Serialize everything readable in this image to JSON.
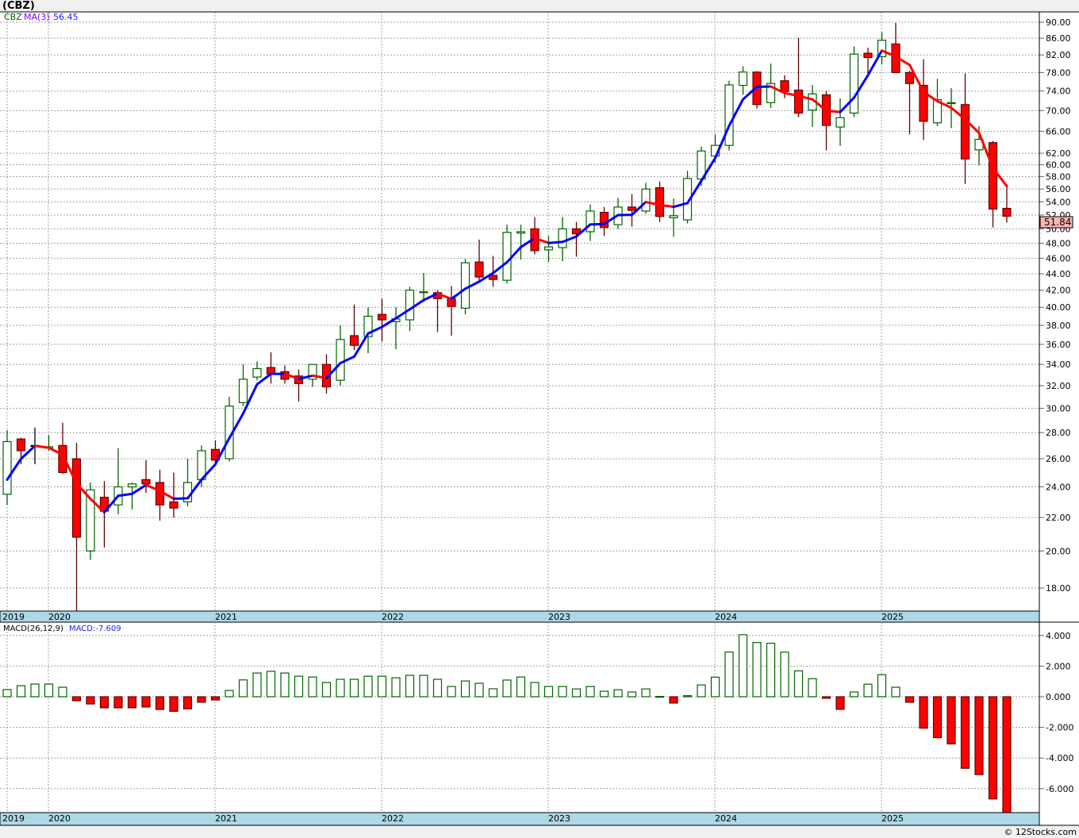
{
  "title": "(CBZ)",
  "legend": {
    "symbol": "CBZ",
    "ma_label": "MA(3)",
    "ma_value": "56.45"
  },
  "macd_legend": {
    "label": "MACD(26,12,9)",
    "value": "MACD:-7.609"
  },
  "last_price": "51.84",
  "footer": "© 12Stocks.com",
  "colors": {
    "up_candle": "#006400",
    "down_candle": "#ff0000",
    "down_outline": "#600000",
    "ma_rising": "#0000ff",
    "ma_falling": "#ff0000",
    "date_band": "#add8e6",
    "last_price_bg": "#ffb4b4"
  },
  "chart_data": [
    {
      "type": "candlestick",
      "ticker": "CBZ",
      "interval": "monthly",
      "y_scale": "log",
      "ylim": [
        16.5,
        92
      ],
      "grid": true,
      "x_tick_labels": [
        "2019",
        "2020",
        "2021",
        "2022",
        "2023",
        "2024",
        "2025"
      ],
      "y_tick_labels": [
        "90.00",
        "86.00",
        "82.00",
        "78.00",
        "74.00",
        "70.00",
        "66.00",
        "62.00",
        "60.00",
        "58.00",
        "56.00",
        "54.00",
        "52.00",
        "50.00",
        "48.00",
        "46.00",
        "44.00",
        "42.00",
        "40.00",
        "38.00",
        "36.00",
        "34.00",
        "32.00",
        "30.00",
        "28.00",
        "26.00",
        "24.00",
        "22.00",
        "20.00",
        "18.00"
      ],
      "dates": [
        "2019-10",
        "2019-11",
        "2019-12",
        "2020-01",
        "2020-02",
        "2020-03",
        "2020-04",
        "2020-05",
        "2020-06",
        "2020-07",
        "2020-08",
        "2020-09",
        "2020-10",
        "2020-11",
        "2020-12",
        "2021-01",
        "2021-02",
        "2021-03",
        "2021-04",
        "2021-05",
        "2021-06",
        "2021-07",
        "2021-08",
        "2021-09",
        "2021-10",
        "2021-11",
        "2021-12",
        "2022-01",
        "2022-02",
        "2022-03",
        "2022-04",
        "2022-05",
        "2022-06",
        "2022-07",
        "2022-08",
        "2022-09",
        "2022-10",
        "2022-11",
        "2022-12",
        "2023-01",
        "2023-02",
        "2023-03",
        "2023-04",
        "2023-05",
        "2023-06",
        "2023-07",
        "2023-08",
        "2023-09",
        "2023-10",
        "2023-11",
        "2023-12",
        "2024-01",
        "2024-02",
        "2024-03",
        "2024-04",
        "2024-05",
        "2024-06",
        "2024-07",
        "2024-08",
        "2024-09",
        "2024-10",
        "2024-11",
        "2024-12",
        "2025-01",
        "2025-02",
        "2025-03",
        "2025-04",
        "2025-05",
        "2025-06",
        "2025-07",
        "2025-08",
        "2025-09",
        "2025-10"
      ],
      "ohlc_fields": [
        "open",
        "high",
        "low",
        "close"
      ],
      "ohlc": [
        [
          23.5,
          28.2,
          22.8,
          27.3
        ],
        [
          27.5,
          27.6,
          25.6,
          26.6
        ],
        [
          27.0,
          28.4,
          25.6,
          27.0
        ],
        [
          26.8,
          27.8,
          26.6,
          26.9
        ],
        [
          27.0,
          28.8,
          24.9,
          25.0
        ],
        [
          26.0,
          27.2,
          16.5,
          20.8
        ],
        [
          20.0,
          24.3,
          19.5,
          23.8
        ],
        [
          23.3,
          24.4,
          20.2,
          22.4
        ],
        [
          22.8,
          26.8,
          22.2,
          24.0
        ],
        [
          24.0,
          24.3,
          22.5,
          24.2
        ],
        [
          24.5,
          25.9,
          23.6,
          24.2
        ],
        [
          24.3,
          25.2,
          21.8,
          22.8
        ],
        [
          23.0,
          25.0,
          22.0,
          22.6
        ],
        [
          23.0,
          26.0,
          22.7,
          24.3
        ],
        [
          24.5,
          27.0,
          24.0,
          26.6
        ],
        [
          26.7,
          27.4,
          25.5,
          25.9
        ],
        [
          26.0,
          31.0,
          25.8,
          30.2
        ],
        [
          30.5,
          34.0,
          30.2,
          32.6
        ],
        [
          32.8,
          34.3,
          32.5,
          33.6
        ],
        [
          33.7,
          35.2,
          32.2,
          33.1
        ],
        [
          33.3,
          33.9,
          32.2,
          32.6
        ],
        [
          32.9,
          33.5,
          30.6,
          32.2
        ],
        [
          32.6,
          34.0,
          31.9,
          34.0
        ],
        [
          34.0,
          35.0,
          31.3,
          31.9
        ],
        [
          32.5,
          38.0,
          32.0,
          36.5
        ],
        [
          36.9,
          40.3,
          35.4,
          35.9
        ],
        [
          36.8,
          40.0,
          35.1,
          39.0
        ],
        [
          39.2,
          41.0,
          36.3,
          38.6
        ],
        [
          38.4,
          40.0,
          35.5,
          38.7
        ],
        [
          38.6,
          42.4,
          37.4,
          42.0
        ],
        [
          41.7,
          44.1,
          40.6,
          41.8
        ],
        [
          41.7,
          42.0,
          37.3,
          41.0
        ],
        [
          41.0,
          42.5,
          36.9,
          40.1
        ],
        [
          39.9,
          45.9,
          39.2,
          45.4
        ],
        [
          45.5,
          48.5,
          42.9,
          43.6
        ],
        [
          43.8,
          46.3,
          42.4,
          43.3
        ],
        [
          43.2,
          50.6,
          42.8,
          49.5
        ],
        [
          49.4,
          50.6,
          45.8,
          49.6
        ],
        [
          50.0,
          51.7,
          46.5,
          47.0
        ],
        [
          47.1,
          49.0,
          45.5,
          47.5
        ],
        [
          47.4,
          51.7,
          45.6,
          50.0
        ],
        [
          50.0,
          51.0,
          46.2,
          49.3
        ],
        [
          49.6,
          53.6,
          48.3,
          52.6
        ],
        [
          52.4,
          53.2,
          49.0,
          50.2
        ],
        [
          50.6,
          54.6,
          50.0,
          53.2
        ],
        [
          53.2,
          55.2,
          50.3,
          52.7
        ],
        [
          52.6,
          57.0,
          52.2,
          56.0
        ],
        [
          56.2,
          57.2,
          51.0,
          51.8
        ],
        [
          51.6,
          54.5,
          48.9,
          51.9
        ],
        [
          51.3,
          59.0,
          50.8,
          57.7
        ],
        [
          57.6,
          63.2,
          56.5,
          62.4
        ],
        [
          61.5,
          65.4,
          60.3,
          63.4
        ],
        [
          63.4,
          76.2,
          62.5,
          75.3
        ],
        [
          75.2,
          79.4,
          73.2,
          78.1
        ],
        [
          78.1,
          78.3,
          70.4,
          71.2
        ],
        [
          71.6,
          80.0,
          70.5,
          75.6
        ],
        [
          76.2,
          77.4,
          72.5,
          73.9
        ],
        [
          74.2,
          86.1,
          68.7,
          69.5
        ],
        [
          70.1,
          75.3,
          66.8,
          73.4
        ],
        [
          73.2,
          74.0,
          62.5,
          67.1
        ],
        [
          66.8,
          72.5,
          63.3,
          68.6
        ],
        [
          69.5,
          84.0,
          68.7,
          82.2
        ],
        [
          82.4,
          83.7,
          77.8,
          81.4
        ],
        [
          81.6,
          87.5,
          79.8,
          85.5
        ],
        [
          84.6,
          89.8,
          77.9,
          78.0
        ],
        [
          78.0,
          78.4,
          65.4,
          75.6
        ],
        [
          75.2,
          81.0,
          64.4,
          67.9
        ],
        [
          67.6,
          76.6,
          67.0,
          72.2
        ],
        [
          71.4,
          74.6,
          66.6,
          71.6
        ],
        [
          71.2,
          77.8,
          56.8,
          61.0
        ],
        [
          62.6,
          67.0,
          59.9,
          64.5
        ],
        [
          63.9,
          64.2,
          50.2,
          52.9
        ],
        [
          53.0,
          56.8,
          50.9,
          51.84
        ]
      ],
      "ma3": [
        24.5,
        26.0,
        26.97,
        26.83,
        26.3,
        24.23,
        23.2,
        22.33,
        23.4,
        23.53,
        24.13,
        23.73,
        23.2,
        23.23,
        24.5,
        25.6,
        27.57,
        29.57,
        32.13,
        33.1,
        33.1,
        32.63,
        32.93,
        32.7,
        34.13,
        34.77,
        37.13,
        37.83,
        38.77,
        39.77,
        40.83,
        41.6,
        40.97,
        42.17,
        43.03,
        44.1,
        45.47,
        47.47,
        48.7,
        48.03,
        48.17,
        48.93,
        50.63,
        50.7,
        52.0,
        52.03,
        53.97,
        53.5,
        53.23,
        53.8,
        57.33,
        61.17,
        67.03,
        72.27,
        74.87,
        74.97,
        73.57,
        73.0,
        72.27,
        70.0,
        69.7,
        72.63,
        77.4,
        83.03,
        81.63,
        79.7,
        73.83,
        71.9,
        70.57,
        68.27,
        65.7,
        59.47,
        56.45
      ]
    },
    {
      "type": "bar",
      "name": "MACD(26,12,9)",
      "ylim": [
        -7.8,
        4.9
      ],
      "grid": true,
      "x_tick_labels": [
        "2019",
        "2020",
        "2021",
        "2022",
        "2023",
        "2024",
        "2025"
      ],
      "y_tick_labels": [
        "4.000",
        "2.000",
        "0.000",
        "-2.000",
        "-4.000",
        "-6.000"
      ],
      "values": [
        0.47,
        0.72,
        0.83,
        0.83,
        0.62,
        -0.26,
        -0.47,
        -0.72,
        -0.72,
        -0.72,
        -0.67,
        -0.83,
        -0.95,
        -0.79,
        -0.36,
        -0.21,
        0.41,
        1.1,
        1.55,
        1.66,
        1.55,
        1.34,
        1.29,
        0.93,
        1.14,
        1.14,
        1.34,
        1.34,
        1.24,
        1.4,
        1.4,
        1.14,
        0.67,
        1.03,
        0.88,
        0.52,
        1.09,
        1.29,
        0.93,
        0.67,
        0.67,
        0.51,
        0.67,
        0.36,
        0.46,
        0.31,
        0.51,
        0.02,
        -0.41,
        0.07,
        0.77,
        1.28,
        2.92,
        4.05,
        3.54,
        3.49,
        2.91,
        1.69,
        1.18,
        -0.1,
        -0.82,
        0.31,
        0.82,
        1.44,
        0.62,
        -0.36,
        -2.05,
        -2.67,
        -3.08,
        -4.67,
        -5.08,
        -6.67,
        -7.609
      ]
    }
  ]
}
